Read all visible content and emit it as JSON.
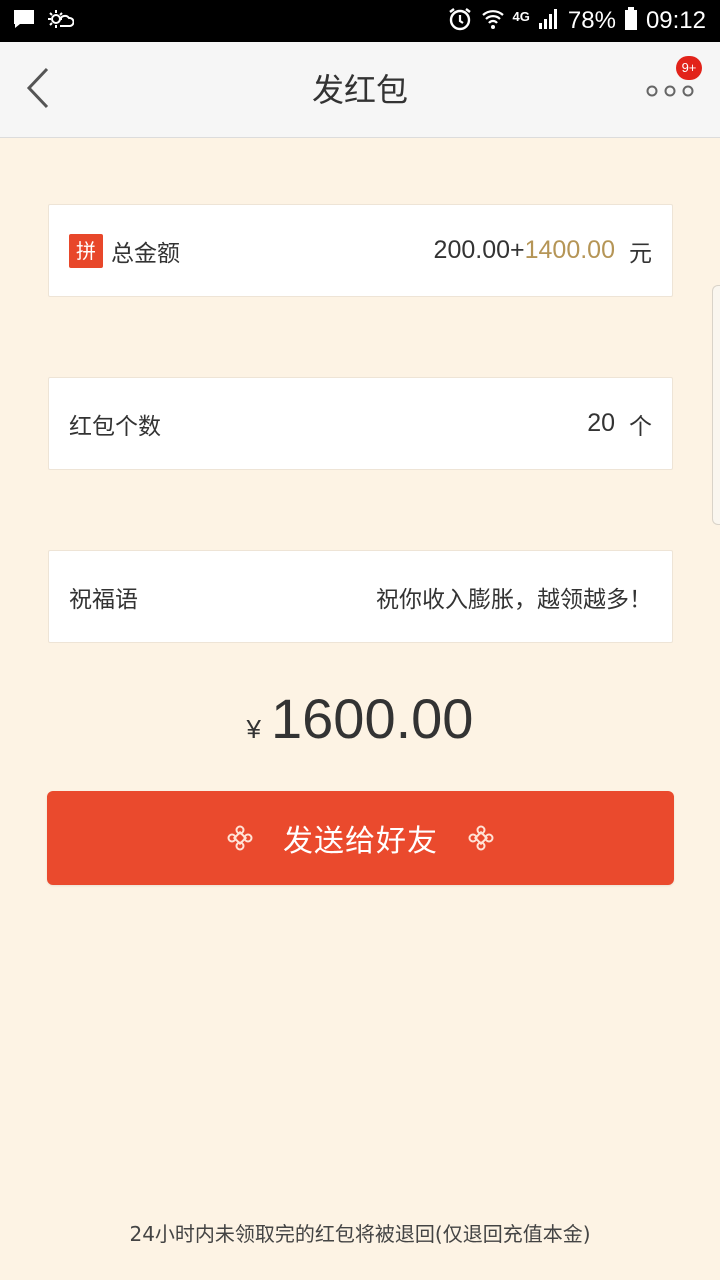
{
  "status_bar": {
    "network": "4G",
    "battery": "78%",
    "time": "09:12"
  },
  "nav": {
    "title": "发红包",
    "badge": "9+"
  },
  "total_amount_row": {
    "tag": "拼",
    "label": "总金额",
    "base": "200.00+",
    "bonus": "1400.00",
    "unit": "元",
    "bonus_color": "#b59556"
  },
  "count_row": {
    "label": "红包个数",
    "value": "20",
    "unit": "个"
  },
  "blessing_row": {
    "label": "祝福语",
    "value": "祝你收入膨胀，越领越多！"
  },
  "total": {
    "symbol": "¥",
    "value": "1600.00"
  },
  "send_button": {
    "label": "发送给好友",
    "color": "#ea4a2d"
  },
  "footer": {
    "note": "24小时内未领取完的红包将被退回(仅退回充值本金)"
  }
}
